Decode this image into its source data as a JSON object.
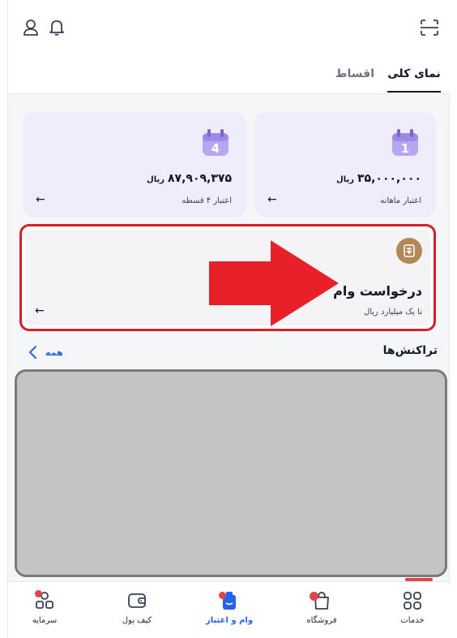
{
  "tabs": [
    {
      "label": "نمای کلی",
      "active": true
    },
    {
      "label": "اقساط",
      "active": false
    }
  ],
  "cards": [
    {
      "calendar_number": "1",
      "amount": "۳۵,۰۰۰,۰۰۰",
      "unit": "ریال",
      "label": "اعتبار ماهانه"
    },
    {
      "calendar_number": "4",
      "amount": "۸۷,۹۰۹,۳۷۵",
      "unit": "ریال",
      "label": "اعتبار ۴ قسطه"
    }
  ],
  "loan": {
    "title": "درخواست وام",
    "subtitle": "تا یک میلیارد ریال"
  },
  "transactions": {
    "title": "تراکنش‌ها",
    "all_label": "همه"
  },
  "bottom_nav": [
    {
      "label": "خدمات",
      "icon": "grid-icon"
    },
    {
      "label": "فروشگاه",
      "icon": "shopping-bag-icon"
    },
    {
      "label": "وام و اعتبار",
      "icon": "loan-credit-icon",
      "active": true
    },
    {
      "label": "کیف پول",
      "icon": "wallet-icon"
    },
    {
      "label": "سرمایه",
      "icon": "investment-icon"
    }
  ],
  "colors": {
    "accent": "#2563eb",
    "highlight_red": "#d51f2a",
    "card_bg": "#efedfb",
    "calendar_purple": "#b9a6f0"
  }
}
